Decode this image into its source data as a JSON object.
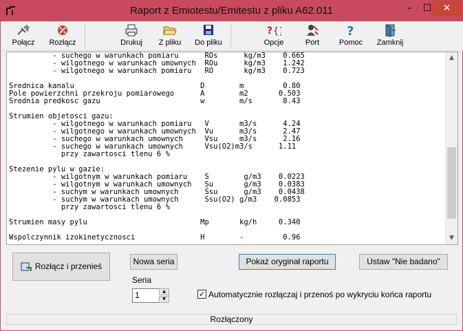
{
  "window": {
    "title": "Raport z Emiotestu/Emitestu z pliku A62.011",
    "minimize": "–",
    "maximize": "☐",
    "close": "✕"
  },
  "toolbar": {
    "connect": "Połącz",
    "disconnect": "Rozłącz",
    "print": "Drukuj",
    "from_file": "Z pliku",
    "to_file": "Do pliku",
    "options": "Opcje",
    "port": "Port",
    "help": "Pomoc",
    "close": "Zamknij"
  },
  "report": {
    "lines": [
      "          - suchego w warunkach pomiaru      ROs      kg/m3    0.665",
      "          - wilgotnego w warunkach umownych  ROu      kg/m3    1.242",
      "          - wilgotnego w warunkach pomiaru   RO       kg/m3    0.723",
      "",
      "Srednica kanalu                             D        m         0.80",
      "Pole powierzchni przekroju pomiarowego      A        m2       0.503",
      "Srednia predkosc gazu                       w        m/s       8.43",
      "",
      "Strumien objetosci gazu:",
      "          - wilgotnego w warunkach pomiaru   V       m3/s      4.24",
      "          - wilgotnego w warunkach umownych  Vu      m3/s      2.47",
      "          - suchego w warunkach umownych     Vsu     m3/s      2.16",
      "          - suchego w warunkach umownych     Vsu(O2)m3/s      1.11",
      "            przy zawartosci tlenu 6 %",
      "",
      "Stezenie pylu w gazie:",
      "          - wilgotnym w warunkach pomiaru    S        g/m3    0.0223",
      "          - wilgotnym w warunkach umownych   Su       g/m3    0.0383",
      "          - suchym w warunkach umownych      Ssu      g/m3    0.0438",
      "          - suchym w warunkach umownych      Ssu(O2) g/m3    0.0853",
      "            przy zawartosci tlenu 6 %",
      "",
      "Strumien masy pylu                          Mp       kg/h     0.340",
      "",
      "Wspolczynnik izokinetycznosci               H        -         0.96"
    ]
  },
  "scrollbar": {
    "up": "▲",
    "down": "▼"
  },
  "controls": {
    "disconnect_move": "Rozłącz i przenieś",
    "new_series": "Nowa seria",
    "show_original": "Pokaż oryginał raportu",
    "set_not_tested": "Ustaw \"Nie badano\"",
    "series_label": "Seria",
    "series_value": "1",
    "spin_up": "▲",
    "spin_down": "▼",
    "auto_checked_mark": "✓",
    "auto_label": "Automatycznie rozłączaj i przenoś po wykryciu końca raportu"
  },
  "status": {
    "text": "Rozłączony"
  },
  "colors": {
    "titlebar": "#c94a5e",
    "close": "#c7463a",
    "help_accent": "#1a7fc4",
    "options_accent": "#d42020"
  }
}
